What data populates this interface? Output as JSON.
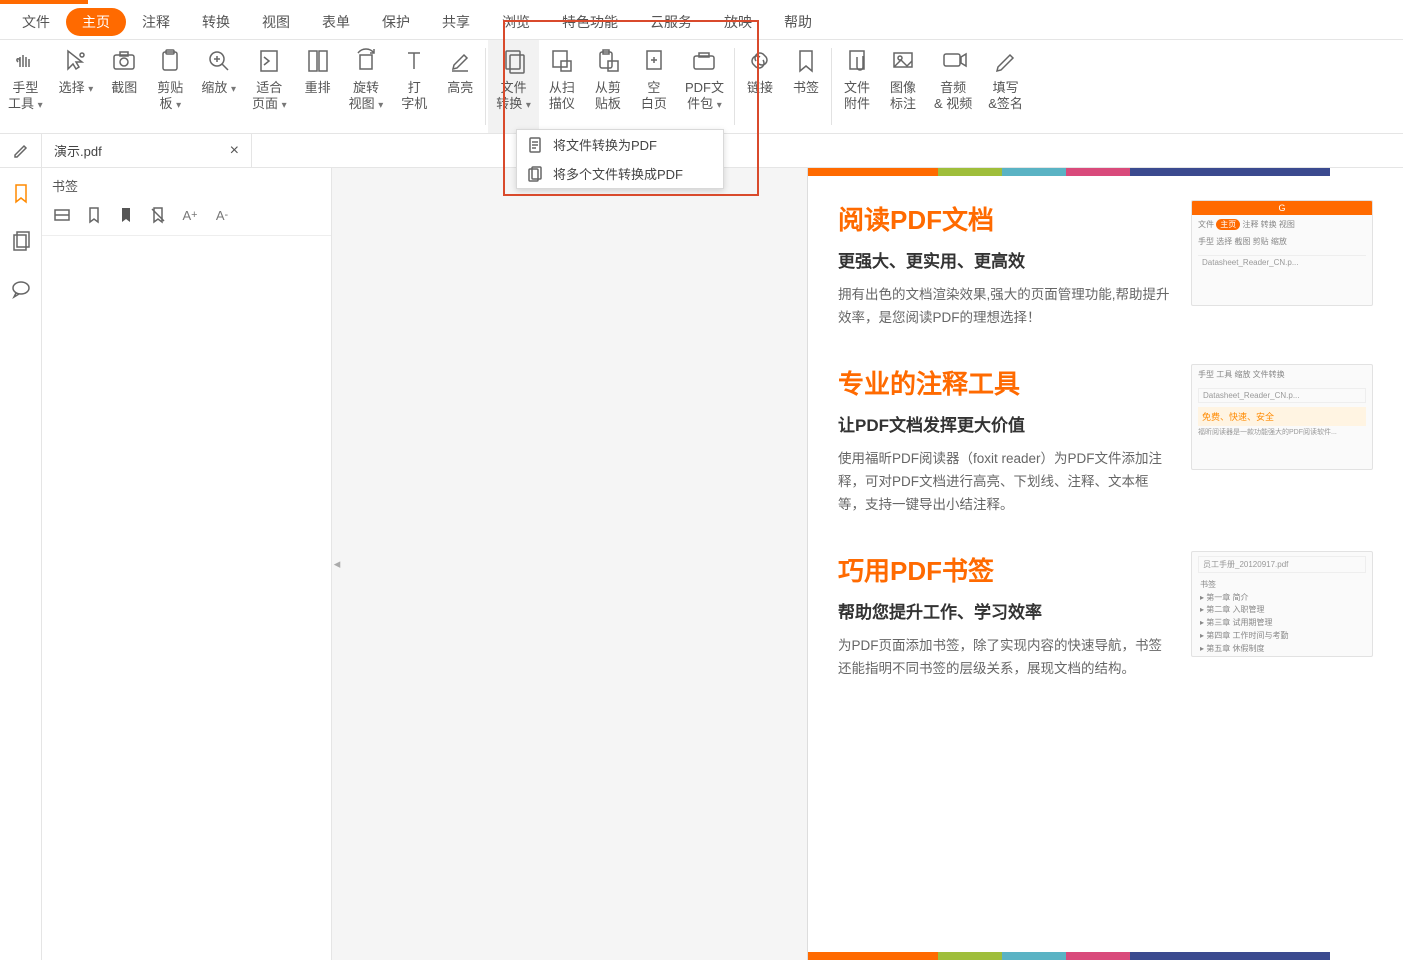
{
  "menu": {
    "items": [
      "文件",
      "主页",
      "注释",
      "转换",
      "视图",
      "表单",
      "保护",
      "共享",
      "浏览",
      "特色功能",
      "云服务",
      "放映",
      "帮助"
    ],
    "active_index": 1
  },
  "ribbon": {
    "groups": [
      {
        "items": [
          {
            "label": "手型\n工具",
            "icon": "hand-icon",
            "drop": true
          },
          {
            "label": "选择",
            "icon": "select-icon",
            "drop": true
          },
          {
            "label": "截图",
            "icon": "snapshot-icon"
          },
          {
            "label": "剪贴\n板",
            "icon": "clipboard-icon",
            "drop": true
          },
          {
            "label": "缩放",
            "icon": "zoom-icon",
            "drop": true
          },
          {
            "label": "适合\n页面",
            "icon": "fitpage-icon",
            "drop": true
          },
          {
            "label": "重排",
            "icon": "reflow-icon"
          },
          {
            "label": "旋转\n视图",
            "icon": "rotate-icon",
            "drop": true
          },
          {
            "label": "打\n字机",
            "icon": "typewriter-icon"
          },
          {
            "label": "高亮",
            "icon": "highlight-icon"
          }
        ]
      },
      {
        "items": [
          {
            "label": "文件\n转换",
            "icon": "fileconvert-icon",
            "drop": true,
            "active": true
          },
          {
            "label": "从扫\n描仪",
            "icon": "scanner-icon"
          },
          {
            "label": "从剪\n贴板",
            "icon": "fromclipboard-icon"
          },
          {
            "label": "空\n白页",
            "icon": "blankpage-icon"
          },
          {
            "label": "PDF文\n件包",
            "icon": "portfolio-icon",
            "drop": true
          }
        ]
      },
      {
        "items": [
          {
            "label": "链接",
            "icon": "link-icon"
          },
          {
            "label": "书签",
            "icon": "bookmark-icon"
          }
        ]
      },
      {
        "items": [
          {
            "label": "文件\n附件",
            "icon": "attachment-icon"
          },
          {
            "label": "图像\n标注",
            "icon": "imgannot-icon"
          },
          {
            "label": "音频\n& 视频",
            "icon": "audiovideo-icon"
          },
          {
            "label": "填写\n&签名",
            "icon": "fillsign-icon"
          }
        ]
      }
    ],
    "dropdown": {
      "items": [
        {
          "label": "将文件转换为PDF",
          "icon": "doc-icon"
        },
        {
          "label": "将多个文件转换成PDF",
          "icon": "multidoc-icon"
        }
      ]
    }
  },
  "tabs": {
    "file_name": "演示.pdf"
  },
  "leftrail": {
    "items": [
      "bookmark",
      "pages",
      "comment"
    ]
  },
  "bookmark_panel": {
    "title": "书签",
    "tools": [
      "expand",
      "add-bookmark",
      "add-sub",
      "delete",
      "font-bigger",
      "font-smaller"
    ]
  },
  "document": {
    "features": [
      {
        "title": "阅读PDF文档",
        "subtitle": "更强大、更实用、更高效",
        "body": "拥有出色的文档渲染效果,强大的页面管理功能,帮助提升效率，是您阅读PDF的理想选择！",
        "thumb": "Datasheet_Reader_CN.p..."
      },
      {
        "title": "专业的注释工具",
        "subtitle": "让PDF文档发挥更大价值",
        "body": "使用福昕PDF阅读器（foxit reader）为PDF文件添加注释，可对PDF文档进行高亮、下划线、注释、文本框等，支持一键导出小结注释。",
        "thumb": "Datasheet_Reader_CN.p..."
      },
      {
        "title": "巧用PDF书签",
        "subtitle": "帮助您提升工作、学习效率",
        "body": "为PDF页面添加书签，除了实现内容的快速导航，书签还能指明不同书签的层级关系，展现文档的结构。",
        "thumb": "员工手册_20120917.pdf"
      }
    ]
  }
}
